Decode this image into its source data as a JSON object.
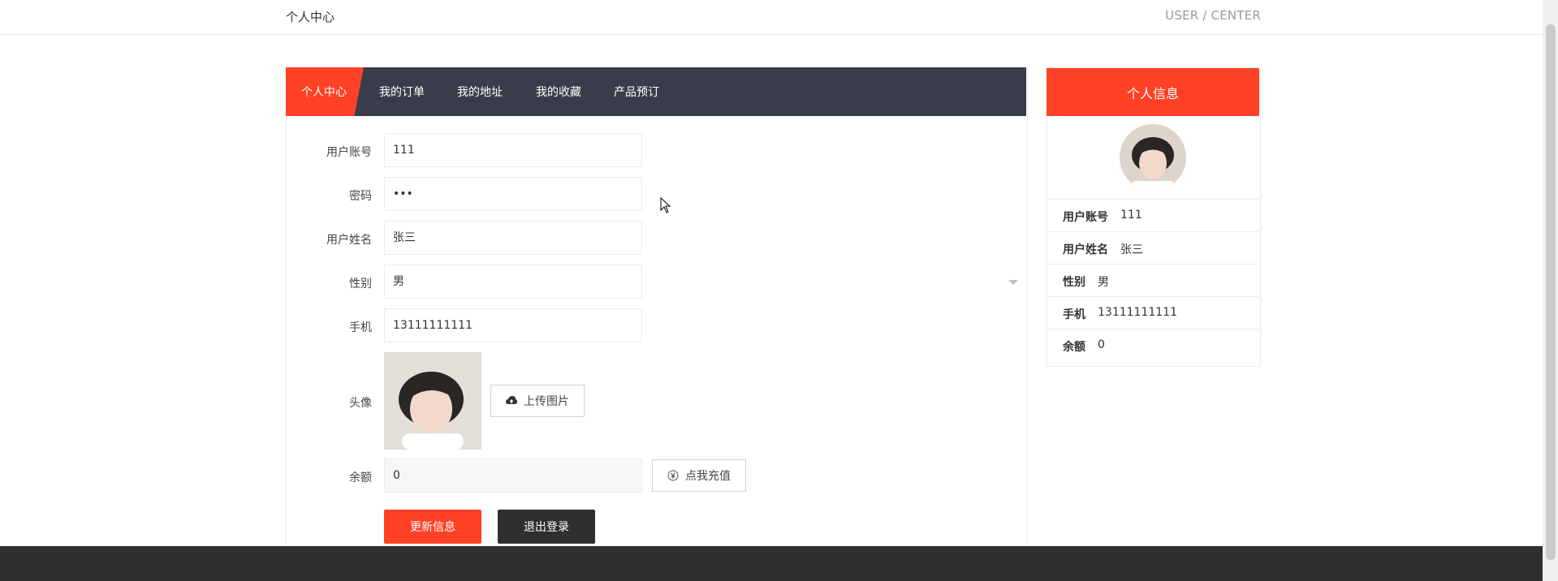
{
  "header": {
    "left_title": "个人中心",
    "right_title": "USER / CENTER"
  },
  "tabs": [
    {
      "label": "个人中心",
      "active": true
    },
    {
      "label": "我的订单"
    },
    {
      "label": "我的地址"
    },
    {
      "label": "我的收藏"
    },
    {
      "label": "产品预订"
    }
  ],
  "form": {
    "account_label": "用户账号",
    "account_value": "111",
    "password_label": "密码",
    "password_value": "•••",
    "name_label": "用户姓名",
    "name_value": "张三",
    "gender_label": "性别",
    "gender_value": "男",
    "phone_label": "手机",
    "phone_value": "13111111111",
    "avatar_label": "头像",
    "upload_label": "上传图片",
    "balance_label": "余额",
    "balance_value": "0",
    "recharge_label": "点我充值",
    "update_label": "更新信息",
    "logout_label": "退出登录"
  },
  "profile": {
    "title": "个人信息",
    "rows": [
      {
        "label": "用户账号",
        "value": "111"
      },
      {
        "label": "用户姓名",
        "value": "张三"
      },
      {
        "label": "性别",
        "value": "男"
      },
      {
        "label": "手机",
        "value": "13111111111"
      },
      {
        "label": "余额",
        "value": "0"
      }
    ]
  },
  "colors": {
    "accent": "#ff4126",
    "tab_bar": "#393d49",
    "footer": "#2f2f2f"
  }
}
